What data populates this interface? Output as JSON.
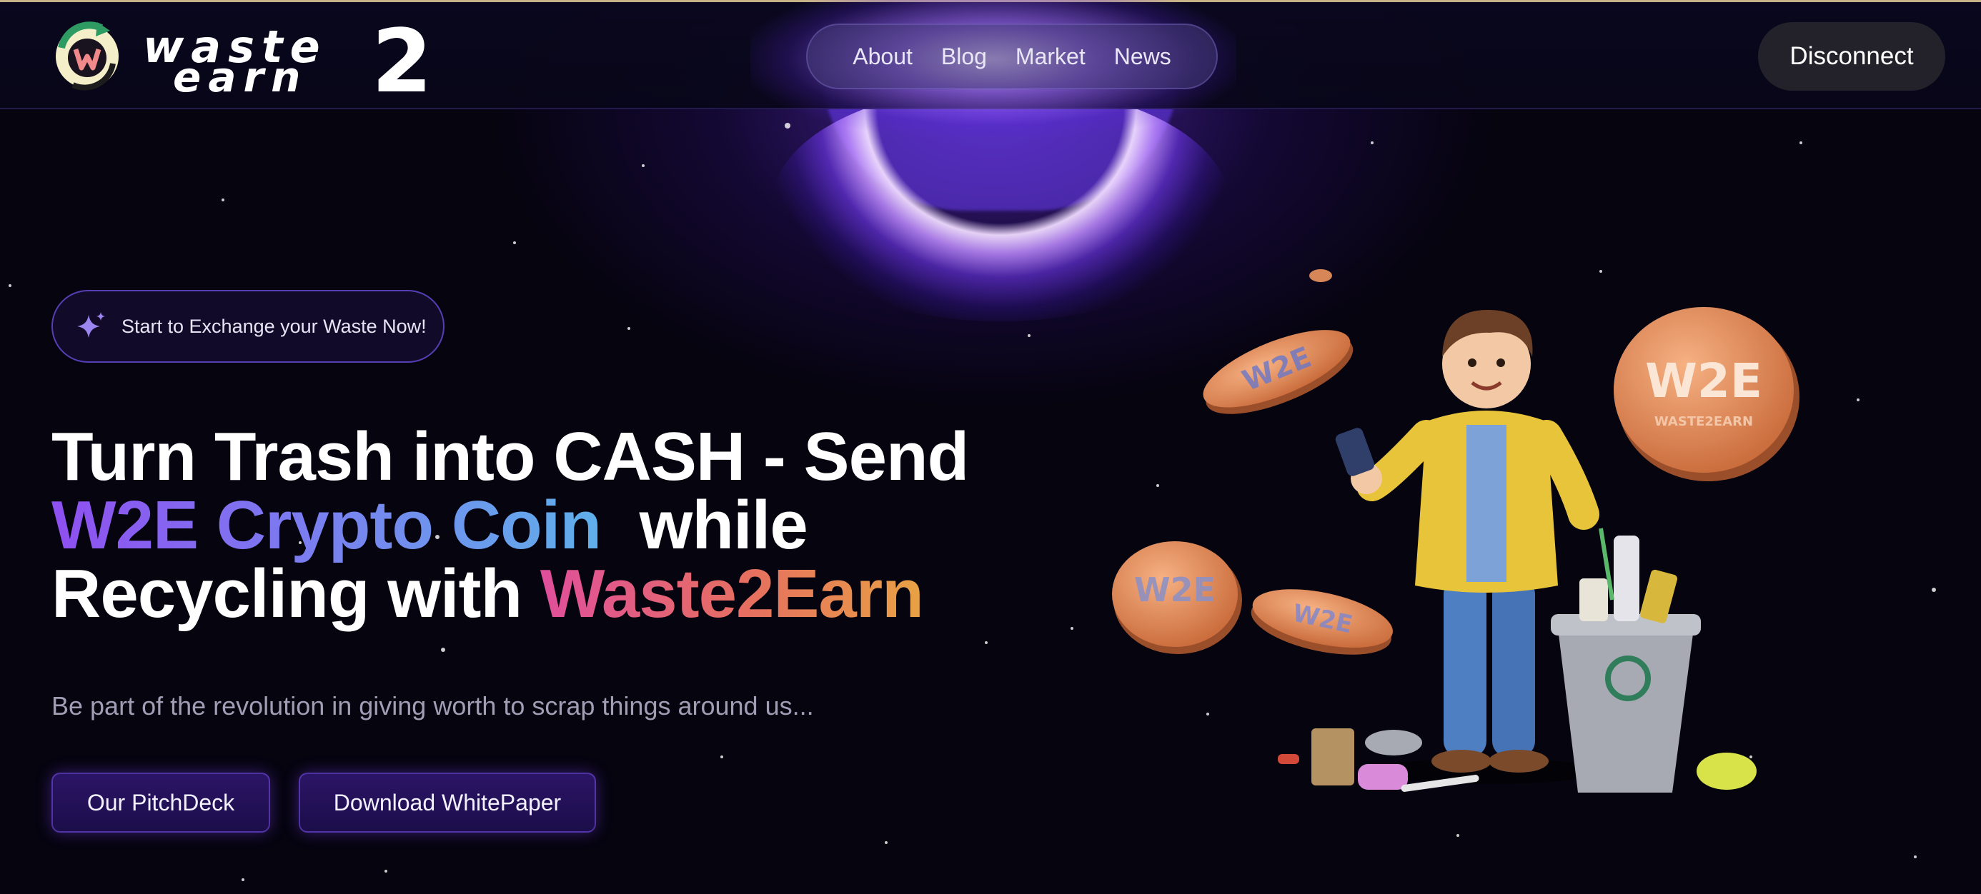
{
  "brand": {
    "line1": "waste",
    "line2": "earn",
    "numeral": "2"
  },
  "nav": {
    "items": [
      "About",
      "Blog",
      "Market",
      "News"
    ]
  },
  "header": {
    "disconnect_label": "Disconnect"
  },
  "hero": {
    "badge": "Start to Exchange your Waste Now!",
    "title": {
      "line1": "Turn Trash into CASH - Send",
      "highlight1": "W2E Crypto Coin",
      "line2_rest": " while",
      "line3_start": "Recycling with ",
      "highlight2": "Waste2Earn"
    },
    "subtitle": "Be part of the revolution in giving worth to scrap things around us...",
    "buttons": {
      "pitchdeck": "Our PitchDeck",
      "whitepaper": "Download WhitePaper"
    }
  },
  "illustration": {
    "coin_text": "W2E",
    "coin_subtext": "WASTE2EARN"
  },
  "colors": {
    "background": "#06040f",
    "accent_purple": "#7b4df0",
    "gradient_blue": "#5fb0ea",
    "gradient_pink": "#e04f9c",
    "gradient_orange": "#e8a244",
    "coin": "#e8935e"
  },
  "icons": {
    "badge_icon": "sparkles-icon",
    "logo_icon": "w-logo-icon"
  }
}
